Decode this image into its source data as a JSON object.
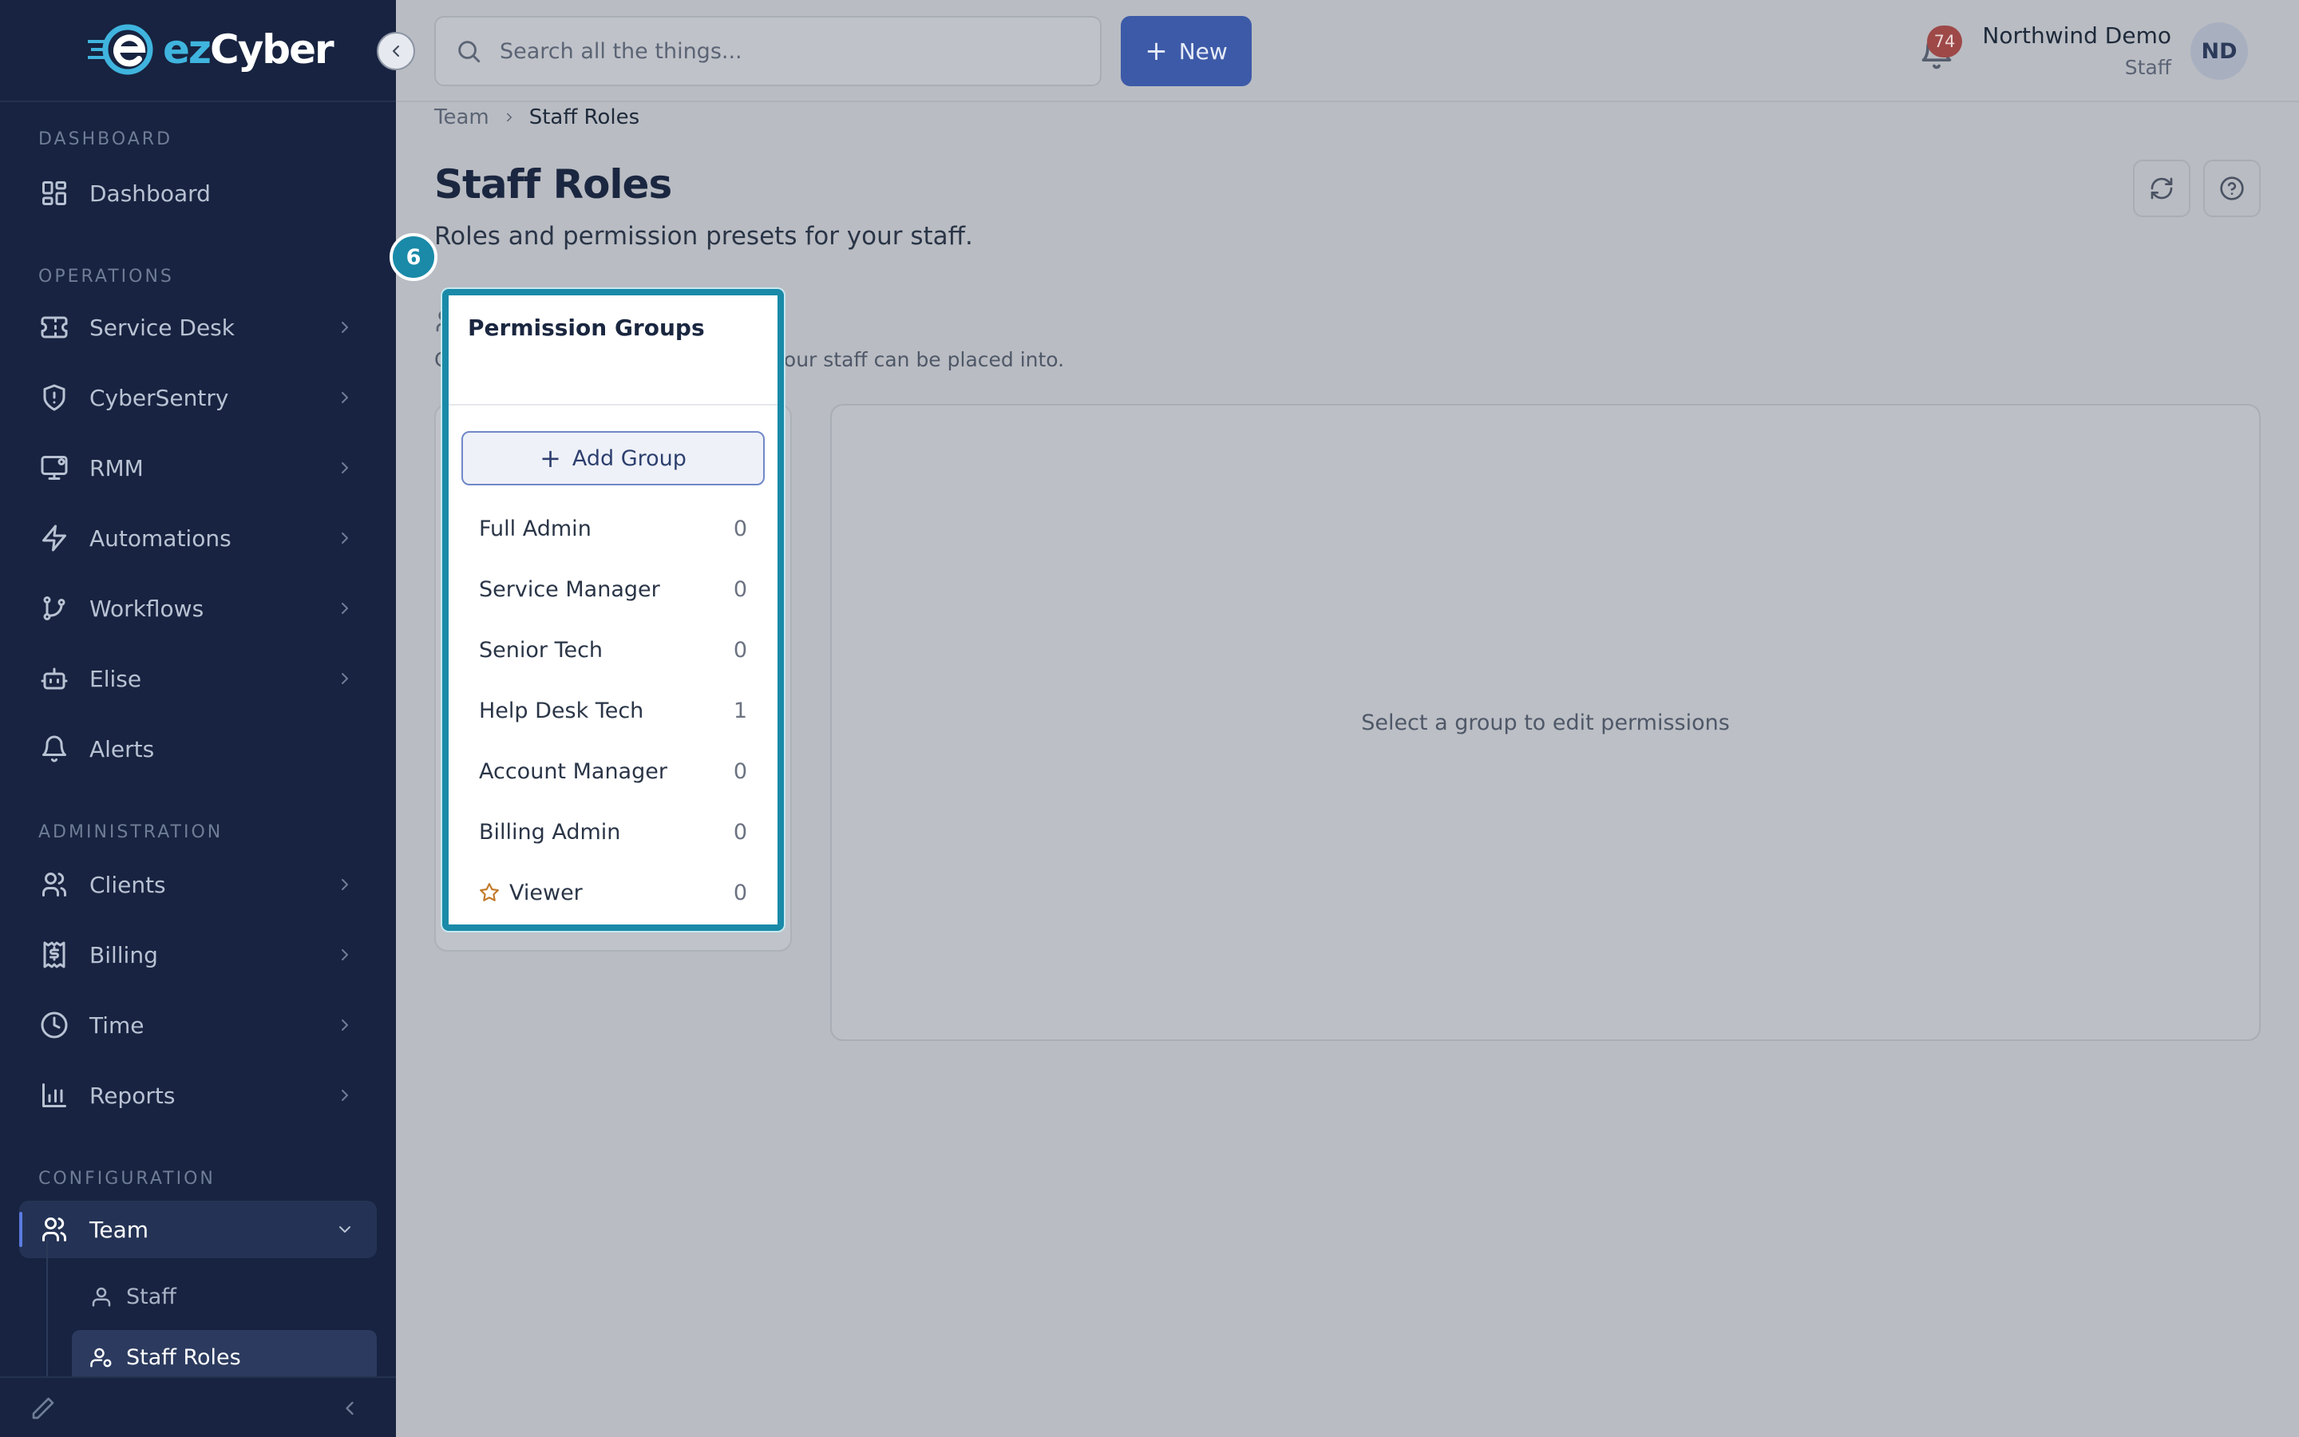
{
  "app": {
    "logo_text_prefix": "ez",
    "logo_text_suffix": "Cyber",
    "brand_color": "#3fb4de",
    "sidebar_color": "#172340"
  },
  "sidebar": {
    "sections": {
      "dashboard": "DASHBOARD",
      "operations": "OPERATIONS",
      "administration": "ADMINISTRATION",
      "configuration": "CONFIGURATION"
    },
    "items": {
      "dashboard": {
        "label": "Dashboard",
        "icon": "grid-icon"
      },
      "service_desk": {
        "label": "Service Desk",
        "icon": "ticket-icon"
      },
      "cybersentry": {
        "label": "CyberSentry",
        "icon": "shield-icon"
      },
      "rmm": {
        "label": "RMM",
        "icon": "monitor-icon"
      },
      "automations": {
        "label": "Automations",
        "icon": "bolt-icon"
      },
      "workflows": {
        "label": "Workflows",
        "icon": "branch-icon"
      },
      "elise": {
        "label": "Elise",
        "icon": "robot-icon"
      },
      "alerts": {
        "label": "Alerts",
        "icon": "bell-icon"
      },
      "clients": {
        "label": "Clients",
        "icon": "users-icon"
      },
      "billing": {
        "label": "Billing",
        "icon": "receipt-icon"
      },
      "time": {
        "label": "Time",
        "icon": "clock-icon"
      },
      "reports": {
        "label": "Reports",
        "icon": "bar-chart-icon"
      },
      "team": {
        "label": "Team",
        "icon": "users-icon"
      }
    },
    "team_subitems": {
      "staff": "Staff",
      "staff_roles": "Staff Roles"
    }
  },
  "topbar": {
    "search_placeholder": "Search all the things...",
    "new_label": "New",
    "notification_count": "74",
    "user_name": "Northwind Demo",
    "user_role": "Staff",
    "user_initials": "ND"
  },
  "breadcrumb": {
    "parent": "Team",
    "current": "Staff Roles"
  },
  "page": {
    "title": "Staff Roles",
    "subtitle": "Roles and permission presets for your staff."
  },
  "permission_groups": {
    "title": "Permission Groups",
    "description": "Create, edit, and assign the roles your staff can be placed into.",
    "add_label": "Add Group",
    "groups": [
      {
        "name": "Full Admin",
        "count": "0",
        "default": false
      },
      {
        "name": "Service Manager",
        "count": "0",
        "default": false
      },
      {
        "name": "Senior Tech",
        "count": "0",
        "default": false
      },
      {
        "name": "Help Desk Tech",
        "count": "1",
        "default": false
      },
      {
        "name": "Account Manager",
        "count": "0",
        "default": false
      },
      {
        "name": "Billing Admin",
        "count": "0",
        "default": false
      },
      {
        "name": "Viewer",
        "count": "0",
        "default": true
      }
    ]
  },
  "detail": {
    "empty_text": "Select a group to edit permissions"
  },
  "tour": {
    "step_number": "6",
    "highlight_color": "#1a8aa8"
  }
}
